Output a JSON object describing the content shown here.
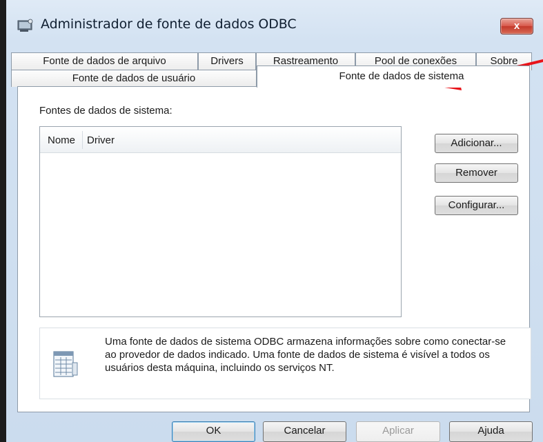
{
  "window": {
    "title": "Administrador de fonte de dados ODBC",
    "close_label": "x"
  },
  "tabs": {
    "row1": [
      {
        "label": "Fonte de dados de arquivo"
      },
      {
        "label": "Drivers"
      },
      {
        "label": "Rastreamento"
      },
      {
        "label": "Pool de conexões"
      },
      {
        "label": "Sobre"
      }
    ],
    "row2": [
      {
        "label": "Fonte de dados de usuário"
      },
      {
        "label": "Fonte de dados de sistema",
        "selected": true
      }
    ]
  },
  "panel": {
    "section_label": "Fontes de dados de sistema:",
    "list_columns": [
      "Nome",
      "Driver"
    ],
    "list_rows": [],
    "side_buttons": {
      "add": "Adicionar...",
      "remove": "Remover",
      "configure": "Configurar..."
    },
    "info_text": "Uma fonte de dados de sistema ODBC armazena informações sobre como conectar-se ao provedor de dados indicado. Uma fonte de dados de sistema é visível a todos os usuários desta máquina, incluindo os serviços NT."
  },
  "footer_buttons": {
    "ok": "OK",
    "cancel": "Cancelar",
    "apply": "Aplicar",
    "help": "Ajuda"
  },
  "colors": {
    "annotation_arrow": "#e8141a",
    "close_button": "#c3392b"
  }
}
